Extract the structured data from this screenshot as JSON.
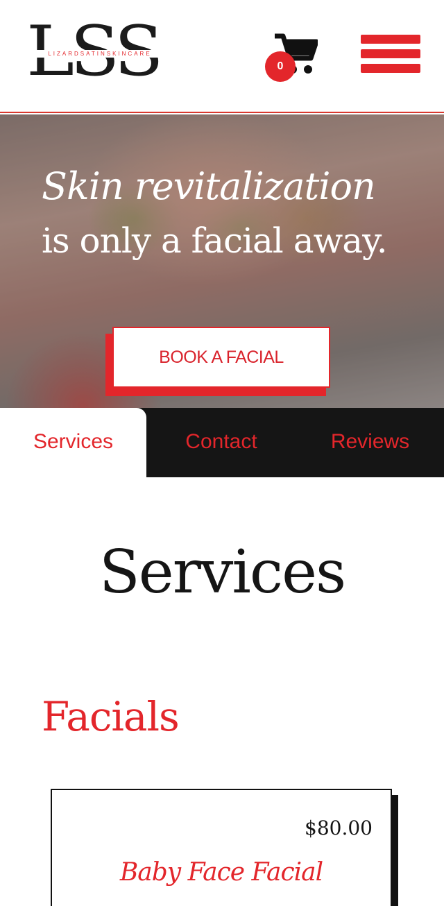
{
  "header": {
    "logo_letters": "LSS",
    "logo_tagline": "LIZARDSATINSKINCARE",
    "cart_count": "0",
    "cart_icon": "shopping-cart-icon",
    "menu_icon": "hamburger-menu-icon"
  },
  "hero": {
    "headline_italic": "Skin revitalization",
    "headline_rest": "is only a facial away.",
    "cta_label": "BOOK A FACIAL"
  },
  "tabs": [
    {
      "label": "Services",
      "active": true
    },
    {
      "label": "Contact",
      "active": false
    },
    {
      "label": "Reviews",
      "active": false
    }
  ],
  "main": {
    "section_title": "Services",
    "category_title": "Facials",
    "services": [
      {
        "price": "$80.00",
        "name": "Baby Face Facial"
      }
    ]
  },
  "colors": {
    "accent": "#e3262b",
    "dark": "#151515",
    "background": "#ffffff"
  }
}
